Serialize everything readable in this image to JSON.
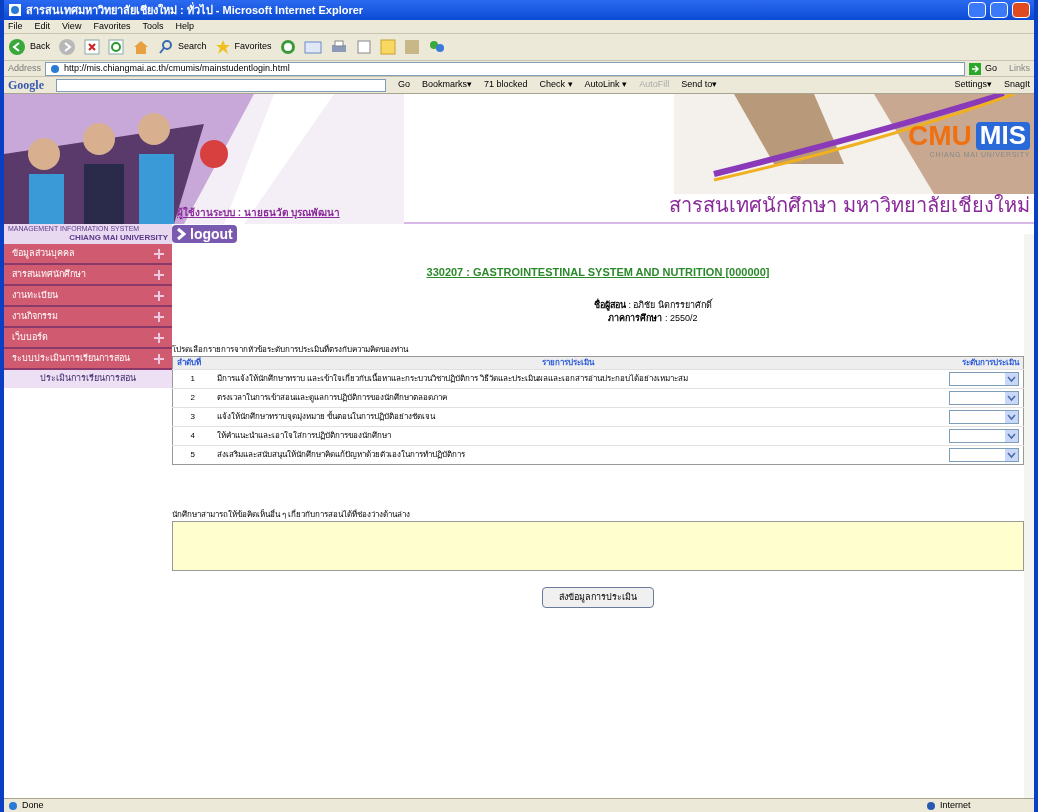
{
  "window": {
    "title": "สารสนเทศมหาวิทยาลัยเชียงใหม่ : ทั่วไป - Microsoft Internet Explorer"
  },
  "menu": [
    "File",
    "Edit",
    "View",
    "Favorites",
    "Tools",
    "Help"
  ],
  "toolbar": {
    "back": "Back",
    "search": "Search",
    "favorites": "Favorites"
  },
  "address_bar": {
    "label": "Address",
    "value": "http://mis.chiangmai.ac.th/cmumis/mainstudentlogin.html",
    "go": "Go",
    "links": "Links"
  },
  "google_bar": {
    "logo": "Google",
    "go": "Go",
    "bookmarks": "Bookmarks▾",
    "blocked": "71 blocked",
    "check": "Check ▾",
    "autolink": "AutoLink ▾",
    "autofill": "AutoFill",
    "send_to": "Send to▾",
    "settings": "Settings▾",
    "snagit": "SnagIt"
  },
  "banner": {
    "logo_left": "CMU",
    "logo_right": "MIS",
    "logo_sub": "CHIANG MAI UNIVERSITY",
    "site_title": "สารสนเทศนักศึกษา มหาวิทยาลัยเชียงใหม่",
    "user": "ผู้ใช้งานระบบ : นายธนวัต บุรณพัฒนา",
    "mis_line1": "MANAGEMENT INFORMATION SYSTEM",
    "mis_line2": "CHIANG MAI UNIVERSITY",
    "logout": "logout"
  },
  "sidebar": {
    "items": [
      {
        "label": "ข้อมูลส่วนบุคคล"
      },
      {
        "label": "สารสนเทศนักศึกษา"
      },
      {
        "label": "งานทะเบียน"
      },
      {
        "label": "งานกิจกรรม"
      },
      {
        "label": "เว็บบอร์ด"
      },
      {
        "label": "ระบบประเมินการเรียนการสอน",
        "children": [
          {
            "label": "ประเมินการเรียนการสอน"
          }
        ]
      }
    ]
  },
  "course": {
    "title": "330207 : GASTROINTESTINAL SYSTEM AND NUTRITION [000000]",
    "instructor": "**ชื่อผู้สอน** : อภิชัย นิตกรรยาศักดิ์",
    "semester": "**ภาคการศึกษา** : 2550/2"
  },
  "instruction": "โปรดเลือกรายการจากหัวข้อระดับการประเมินที่ตรงกับความคิดของท่าน",
  "table": {
    "columns": [
      "ลำดับที่",
      "รายการประเมิน",
      "ระดับการประเมิน"
    ],
    "rows": [
      {
        "no": "1",
        "item": "มีการแจ้งให้นักศึกษาทราบ และเข้าใจเกี่ยวกับเนื้อหาและกระบวนวิชาปฏิบัติการ วิธีวัดและประเมินผลและเอกสารอ่านประกอบได้อย่างเหมาะสม"
      },
      {
        "no": "2",
        "item": "ตรงเวลาในการเข้าสอนและดูแลการปฏิบัติการของนักศึกษาตลอดภาค"
      },
      {
        "no": "3",
        "item": "แจ้งให้นักศึกษาทราบจุดมุ่งหมาย ขั้นตอนในการปฏิบัติอย่างชัดเจน"
      },
      {
        "no": "4",
        "item": "ให้คำแนะนำและเอาใจใส่การปฏิบัติการของนักศึกษา"
      },
      {
        "no": "5",
        "item": "ส่งเสริมและสนับสนุนให้นักศึกษาคิดแก้ปัญหาด้วยตัวเองในการทำปฏิบัติการ"
      }
    ]
  },
  "comment": {
    "label": "นักศึกษาสามารถให้ข้อคิดเห็นอื่น ๆ เกี่ยวกับการสอนได้ที่ช่องว่างด้านล่าง"
  },
  "submit": "ส่งข้อมูลการประเมิน",
  "status_bar": {
    "text": "Done",
    "zone": "Internet"
  }
}
